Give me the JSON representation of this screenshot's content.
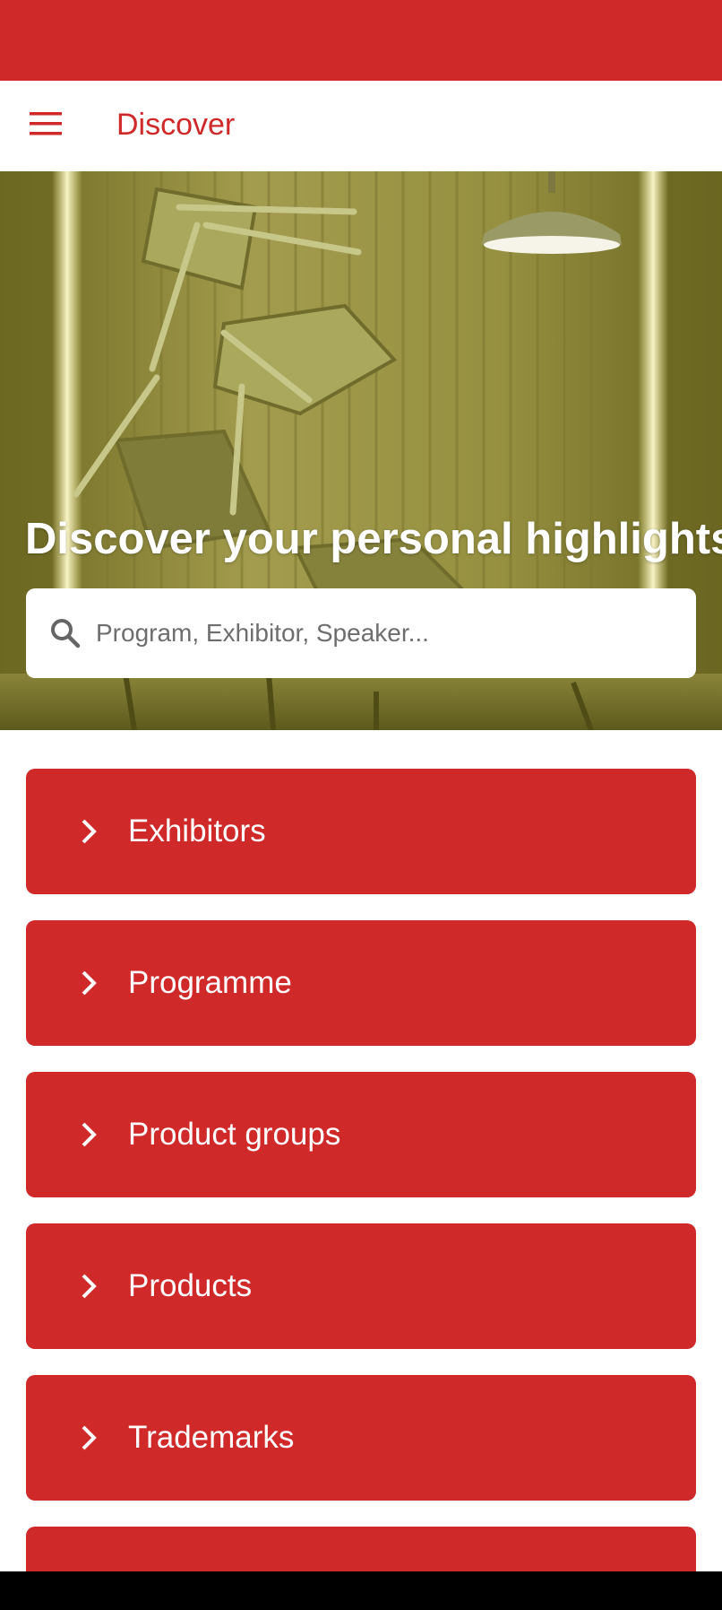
{
  "app": {
    "title": "Discover"
  },
  "hero": {
    "headline": "Discover your personal highlights",
    "search": {
      "placeholder": "Program, Exhibitor, Speaker...",
      "value": ""
    }
  },
  "nav": {
    "items": [
      {
        "label": "Exhibitors",
        "icon": "chevron-right-icon"
      },
      {
        "label": "Programme",
        "icon": "chevron-right-icon"
      },
      {
        "label": "Product groups",
        "icon": "chevron-right-icon"
      },
      {
        "label": "Products",
        "icon": "chevron-right-icon"
      },
      {
        "label": "Trademarks",
        "icon": "chevron-right-icon"
      }
    ]
  },
  "colors": {
    "brand": "#d0292a",
    "background": "#ffffff",
    "hero_tint": "#8f8a3a"
  },
  "icons": {
    "menu": "hamburger-menu-icon",
    "search": "search-icon",
    "chevron": "chevron-right-icon"
  }
}
